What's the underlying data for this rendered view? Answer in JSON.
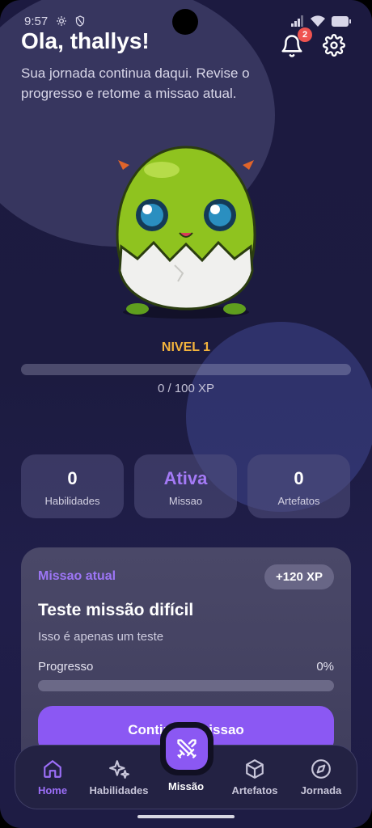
{
  "status_bar": {
    "time": "9:57"
  },
  "greeting": {
    "title": "Ola, thallys!",
    "subtitle": "Sua jornada continua daqui. Revise o progresso e retome a missao atual."
  },
  "notifications": {
    "count": "2"
  },
  "pet": {
    "level_label": "NIVEL 1",
    "xp_text": "0 / 100 XP",
    "xp_progress": 0
  },
  "stats": [
    {
      "value": "0",
      "label": "Habilidades"
    },
    {
      "value": "Ativa",
      "label": "Missao"
    },
    {
      "value": "0",
      "label": "Artefatos"
    }
  ],
  "mission": {
    "label": "Missao atual",
    "xp_badge": "+120 XP",
    "title": "Teste missão difícil",
    "description": "Isso é apenas um teste",
    "progress_label": "Progresso",
    "progress_value": "0%",
    "progress": 0,
    "cta": "Continuar missao"
  },
  "nav": {
    "items": [
      {
        "label": "Home",
        "icon": "home-icon"
      },
      {
        "label": "Habilidades",
        "icon": "sparkles-icon"
      },
      {
        "label": "Missão",
        "icon": "crossed-swords-icon"
      },
      {
        "label": "Artefatos",
        "icon": "cube-icon"
      },
      {
        "label": "Jornada",
        "icon": "compass-icon"
      }
    ]
  },
  "colors": {
    "accent": "#8b58f3",
    "level": "#f3b33d",
    "badge": "#ef5350"
  }
}
